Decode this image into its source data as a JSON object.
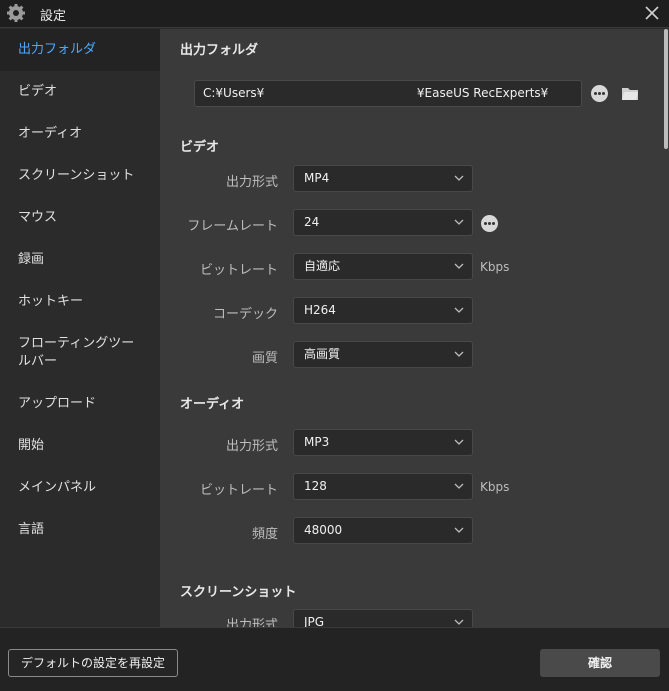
{
  "window": {
    "title": "設定"
  },
  "sidebar": {
    "items": [
      {
        "label": "出力フォルダ",
        "active": true
      },
      {
        "label": "ビデオ"
      },
      {
        "label": "オーディオ"
      },
      {
        "label": "スクリーンショット"
      },
      {
        "label": "マウス"
      },
      {
        "label": "録画"
      },
      {
        "label": "ホットキー"
      },
      {
        "label": "フローティングツールバー"
      },
      {
        "label": "アップロード"
      },
      {
        "label": "開始"
      },
      {
        "label": "メインパネル"
      },
      {
        "label": "言語"
      }
    ]
  },
  "output_folder": {
    "title": "出力フォルダ",
    "path": "C:¥Users¥                                        ¥EaseUS RecExperts¥"
  },
  "video": {
    "title": "ビデオ",
    "format_label": "出力形式",
    "format_value": "MP4",
    "framerate_label": "フレームレート",
    "framerate_value": "24",
    "bitrate_label": "ビットレート",
    "bitrate_value": "自適応",
    "bitrate_unit": "Kbps",
    "codec_label": "コーデック",
    "codec_value": "H264",
    "quality_label": "画質",
    "quality_value": "高画質"
  },
  "audio": {
    "title": "オーディオ",
    "format_label": "出力形式",
    "format_value": "MP3",
    "bitrate_label": "ビットレート",
    "bitrate_value": "128",
    "bitrate_unit": "Kbps",
    "frequency_label": "頻度",
    "frequency_value": "48000"
  },
  "screenshot": {
    "title": "スクリーンショット",
    "format_label": "出力形式",
    "format_value": "JPG"
  },
  "footer": {
    "reset_label": "デフォルトの設定を再設定",
    "confirm_label": "確認"
  },
  "colors": {
    "accent": "#4ea8ff",
    "panel": "#3a3a3a",
    "sidebar": "#2b2b2b"
  },
  "icons": {
    "title": "gear-icon",
    "close": "close-icon",
    "more": "more-icon",
    "folder": "folder-icon",
    "dropdown": "chevron-down-icon"
  }
}
